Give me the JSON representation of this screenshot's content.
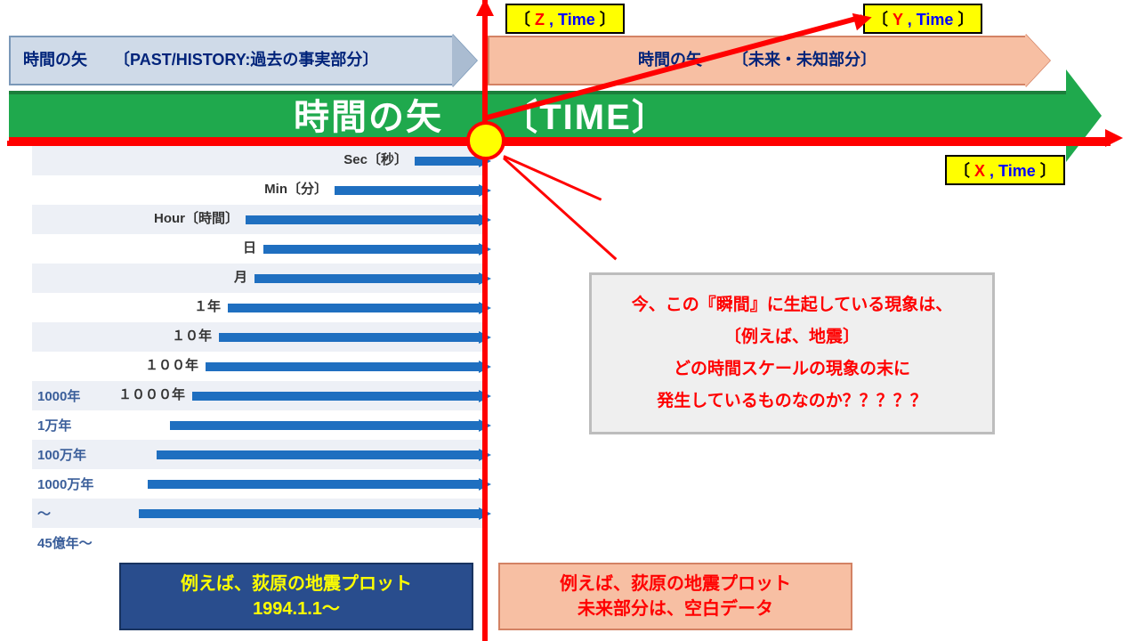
{
  "axes": {
    "z": {
      "var": "Z",
      "t": "Time"
    },
    "y": {
      "var": "Y",
      "t": "Time"
    },
    "x": {
      "var": "X",
      "t": "Time"
    }
  },
  "past_arrow": {
    "prefix": "時間の矢",
    "text": "〔PAST/HISTORY:過去の事実部分〕"
  },
  "future_arrow": {
    "prefix": "時間の矢",
    "text": "〔未来・未知部分〕"
  },
  "green_banner": {
    "left": "時間の矢",
    "right": "〔TIME〕"
  },
  "scales": [
    {
      "left": "",
      "label": "Sec〔秒〕",
      "start": 430
    },
    {
      "left": "",
      "label": "Min〔分〕",
      "start": 340
    },
    {
      "left": "",
      "label": "Hour〔時間〕",
      "start": 240
    },
    {
      "left": "",
      "label": "日",
      "start": 260
    },
    {
      "left": "",
      "label": "月",
      "start": 250
    },
    {
      "left": "",
      "label": "１年",
      "start": 220
    },
    {
      "left": "",
      "label": "１０年",
      "start": 210
    },
    {
      "left": "",
      "label": "１００年",
      "start": 195
    },
    {
      "left": "1000年",
      "label": "１０００年",
      "start": 180
    },
    {
      "left": "1万年",
      "label": "",
      "start": 155
    },
    {
      "left": "100万年",
      "label": "",
      "start": 140
    },
    {
      "left": "1000万年",
      "label": "",
      "start": 130
    },
    {
      "left": "～",
      "label": "",
      "start": 120
    },
    {
      "left": "45億年～",
      "label": "",
      "start": 0,
      "noarrow": true
    }
  ],
  "callout": {
    "l1": "今、この『瞬間』に生起している現象は、",
    "l2": "〔例えば、地震〕",
    "l3": "どの時間スケールの現象の末に",
    "l4": "発生しているものなのか？？？？？"
  },
  "bottom": {
    "past": {
      "l1": "例えば、荻原の地震プロット",
      "l2": "1994.1.1～"
    },
    "future": {
      "l1": "例えば、荻原の地震プロット",
      "l2": "未来部分は、空白データ"
    }
  }
}
